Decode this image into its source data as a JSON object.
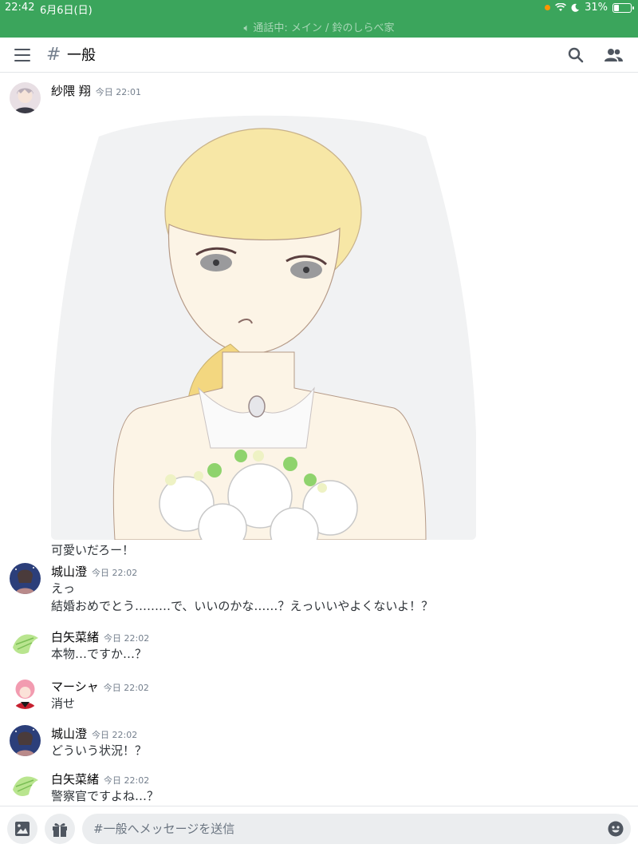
{
  "status": {
    "time": "22:42",
    "date": "6月6日(日)",
    "call_banner": "通話中: メイン / 鈴のしらべ家",
    "battery": "31%"
  },
  "header": {
    "channel_hash": "#",
    "channel_name": "一般"
  },
  "messages": [
    {
      "author": "紗隈 翔",
      "timestamp": "今日 22:01",
      "lines": [
        "可愛いだろー！"
      ],
      "has_image": true
    },
    {
      "author": "城山澄",
      "timestamp": "今日 22:02",
      "lines": [
        "えっ",
        "結婚おめでとう………で、いいのかな……？えっいいやよくないよ！？"
      ]
    },
    {
      "author": "白矢菜緒",
      "timestamp": "今日 22:02",
      "lines": [
        "本物…ですか…？"
      ]
    },
    {
      "author": "マーシャ",
      "timestamp": "今日 22:02",
      "lines": [
        "消せ"
      ]
    },
    {
      "author": "城山澄",
      "timestamp": "今日 22:02",
      "lines": [
        "どういう状況！？"
      ]
    },
    {
      "author": "白矢菜緒",
      "timestamp": "今日 22:02",
      "lines": [
        "警察官ですよね…？"
      ]
    }
  ],
  "composer": {
    "placeholder": "#一般へメッセージを送信"
  },
  "colors": {
    "status_bar": "#3ba55c",
    "timestamp": "#747f8d",
    "composer_bg": "#ebedef"
  }
}
